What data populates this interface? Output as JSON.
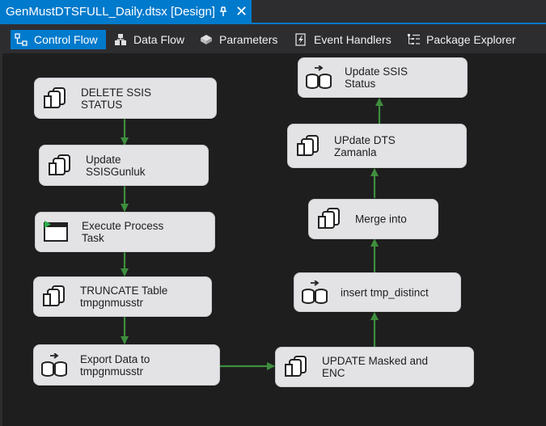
{
  "document_tab": {
    "title": "GenMustDTSFULL_Daily.dtsx [Design]",
    "pin_icon": "pin-icon",
    "close_glyph": "✕"
  },
  "designer_tabs": [
    {
      "label": "Control Flow",
      "icon": "control-flow-icon",
      "active": true
    },
    {
      "label": "Data Flow",
      "icon": "data-flow-icon",
      "active": false
    },
    {
      "label": "Parameters",
      "icon": "parameters-icon",
      "active": false
    },
    {
      "label": "Event Handlers",
      "icon": "event-handlers-icon",
      "active": false
    },
    {
      "label": "Package Explorer",
      "icon": "package-explorer-icon",
      "active": false
    }
  ],
  "tasks": [
    {
      "label": "DELETE SSIS\nSTATUS",
      "type": "execute-sql"
    },
    {
      "label": "Update\nSSISGunluk",
      "type": "execute-sql"
    },
    {
      "label": "Execute Process\nTask",
      "type": "execute-process"
    },
    {
      "label": "TRUNCATE Table\ntmpgnmusstr",
      "type": "execute-sql"
    },
    {
      "label": "Export Data to\ntmpgnmusstr",
      "type": "data-flow"
    },
    {
      "label": "UPDATE Masked and\nENC",
      "type": "execute-sql"
    },
    {
      "label": "insert tmp_distinct",
      "type": "data-flow"
    },
    {
      "label": "Merge into",
      "type": "execute-sql"
    },
    {
      "label": "UPdate DTS\nZamanla",
      "type": "execute-sql"
    },
    {
      "label": "Update SSIS\nStatus",
      "type": "data-flow"
    }
  ],
  "colors": {
    "accent": "#007acc",
    "canvas": "#1e1e1e",
    "toolbar": "#2d2d30",
    "task_fill": "#e3e3e6",
    "precedence_arrow": "#3e8e3e"
  }
}
